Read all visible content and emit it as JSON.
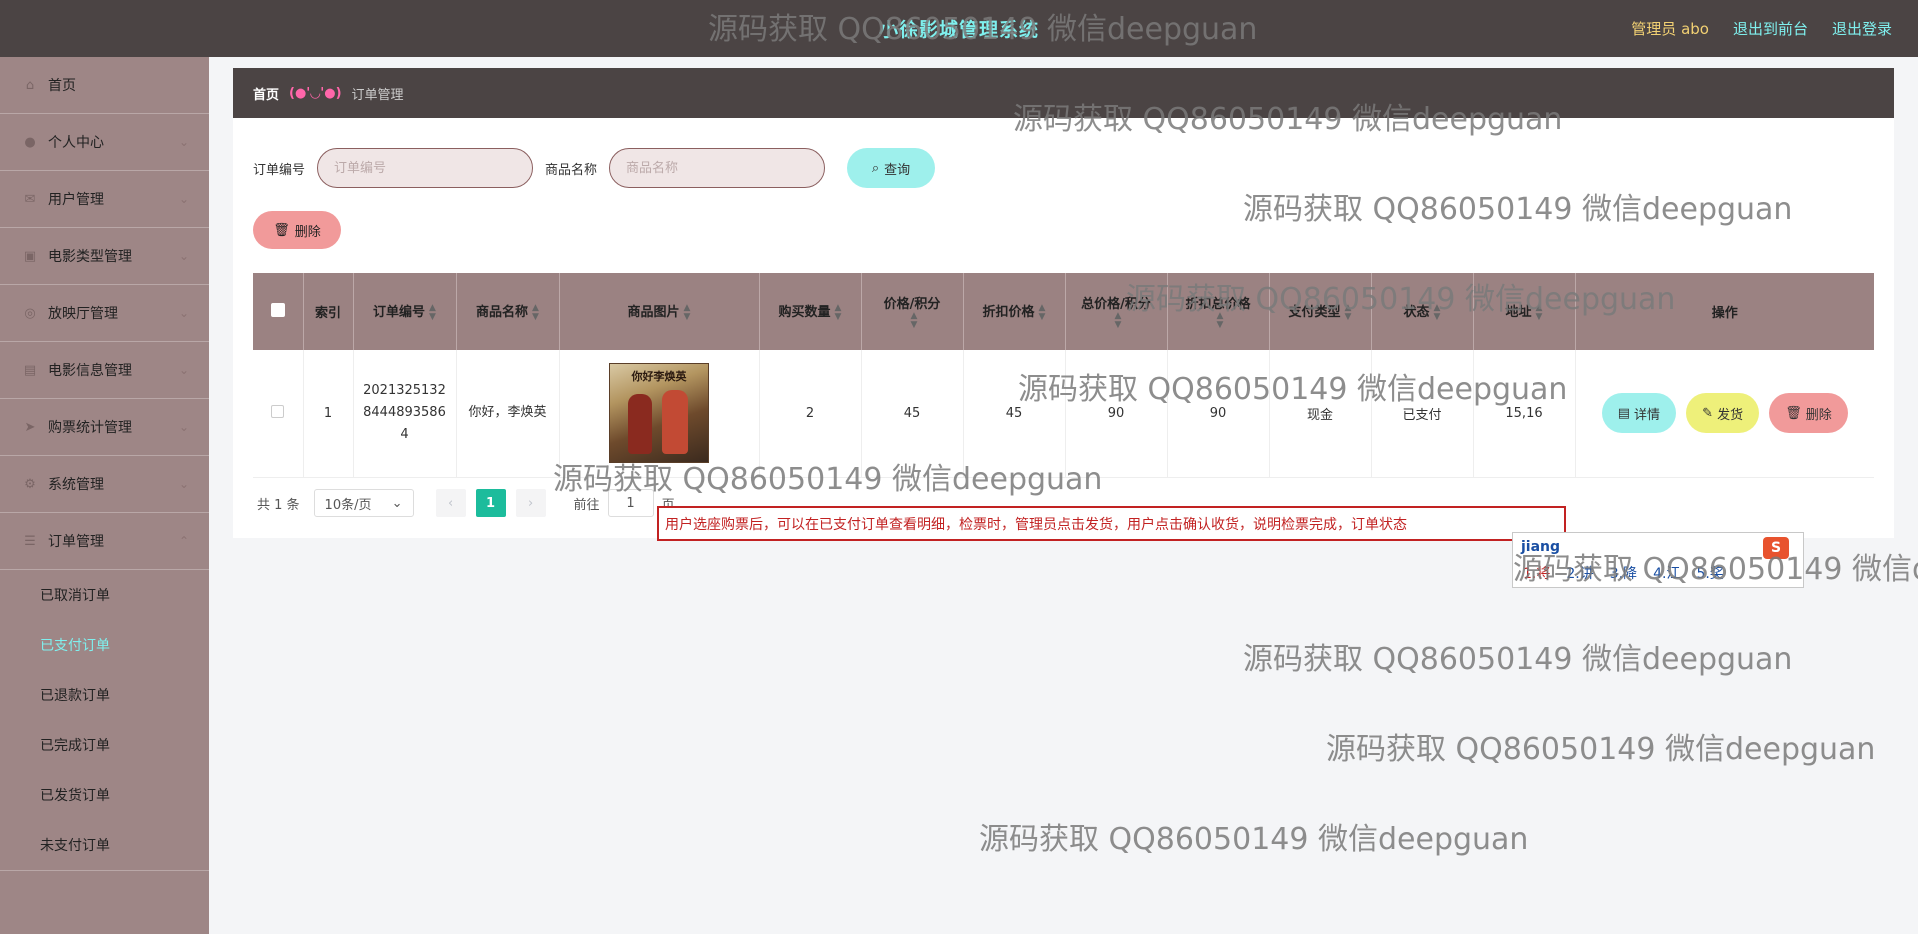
{
  "header": {
    "title": "小徐影城管理系统",
    "admin_label": "管理员 abo",
    "front_link": "退出到前台",
    "logout_link": "退出登录"
  },
  "sidebar": {
    "items": [
      {
        "label": "首页",
        "icon": "home-icon"
      },
      {
        "label": "个人中心",
        "icon": "user-icon"
      },
      {
        "label": "用户管理",
        "icon": "mail-icon"
      },
      {
        "label": "电影类型管理",
        "icon": "film-icon"
      },
      {
        "label": "放映厅管理",
        "icon": "camera-icon"
      },
      {
        "label": "电影信息管理",
        "icon": "film-info-icon"
      },
      {
        "label": "购票统计管理",
        "icon": "send-icon"
      },
      {
        "label": "系统管理",
        "icon": "settings-icon"
      },
      {
        "label": "订单管理",
        "icon": "order-icon"
      }
    ],
    "order_submenu": [
      "已取消订单",
      "已支付订单",
      "已退款订单",
      "已完成订单",
      "已发货订单",
      "未支付订单"
    ]
  },
  "breadcrumb": {
    "home": "首页",
    "face": "(●'◡'●)",
    "current": "订单管理"
  },
  "search": {
    "order_no_label": "订单编号",
    "order_no_placeholder": "订单编号",
    "product_label": "商品名称",
    "product_placeholder": "商品名称",
    "query_label": "查询",
    "delete_label": "删除"
  },
  "table": {
    "headers": [
      "索引",
      "订单编号",
      "商品名称",
      "商品图片",
      "购买数量",
      "价格/积分",
      "折扣价格",
      "总价格/积分",
      "折扣总价格",
      "支付类型",
      "状态",
      "地址",
      "操作"
    ],
    "rows": [
      {
        "index": "1",
        "order_no": "202132513284448935864",
        "product": "你好，李焕英",
        "poster_title": "你好李焕英",
        "qty": "2",
        "price": "45",
        "discount_price": "45",
        "total": "90",
        "discount_total": "90",
        "pay_type": "现金",
        "status": "已支付",
        "address": "15,16"
      }
    ],
    "actions": {
      "detail": "详情",
      "ship": "发货",
      "delete": "删除"
    }
  },
  "pagination": {
    "total": "共 1 条",
    "page_size": "10条/页",
    "current_page": "1",
    "goto_label": "前往",
    "goto_value": "1",
    "page_suffix": "页"
  },
  "note": "用户选座购票后，可以在已支付订单查看明细，检票时，管理员点击发货，用户点击确认收货，说明检票完成，订单状态",
  "ime": {
    "pinyin": "jiang",
    "candidates": [
      "1.将",
      "2.讲",
      "3.降",
      "4.江",
      "5.奖"
    ]
  },
  "watermark": "源码获取 QQ86050149 微信deepguan",
  "colors": {
    "topbar": "#4b4444",
    "sidebar": "#9e8686",
    "accent_cyan": "#7ff0ee",
    "table_header": "#9b8282",
    "active_page": "#1cbc9c",
    "danger": "#f19a9a"
  }
}
